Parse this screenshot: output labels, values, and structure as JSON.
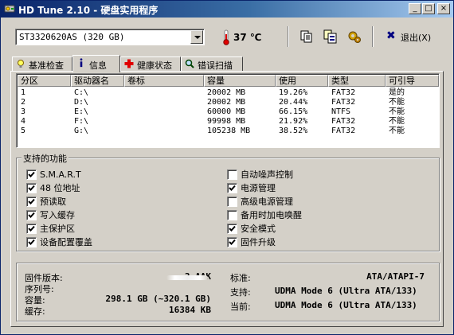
{
  "window": {
    "title": "HD Tune 2.10 - 硬盘实用程序",
    "min_label": "_",
    "max_label": "□",
    "close_label": "×"
  },
  "toolbar": {
    "drive": "ST3320620AS (320 GB)",
    "temperature": "37 ℃",
    "exit_label": "退出(X)"
  },
  "tabs": [
    {
      "label": "基准检查",
      "icon": "bulb-icon"
    },
    {
      "label": "信息",
      "icon": "info-icon",
      "active": true
    },
    {
      "label": "健康状态",
      "icon": "red-cross-icon"
    },
    {
      "label": "错误扫描",
      "icon": "magnifier-icon"
    }
  ],
  "partitions": {
    "headers": [
      "分区",
      "驱动器名",
      "卷标",
      "容量",
      "使用",
      "类型",
      "可引导"
    ],
    "rows": [
      [
        "1",
        "C:\\",
        "",
        "20002 MB",
        "19.26%",
        "FAT32",
        "是的"
      ],
      [
        "2",
        "D:\\",
        "",
        "20002 MB",
        "20.44%",
        "FAT32",
        "不能"
      ],
      [
        "3",
        "E:\\",
        "",
        "60000 MB",
        "66.15%",
        "NTFS",
        "不能"
      ],
      [
        "4",
        "F:\\",
        "",
        "99998 MB",
        "21.92%",
        "FAT32",
        "不能"
      ],
      [
        "5",
        "G:\\",
        "",
        "105238 MB",
        "38.52%",
        "FAT32",
        "不能"
      ]
    ]
  },
  "features": {
    "title": "支持的功能",
    "left": [
      {
        "label": "S.M.A.R.T",
        "checked": true
      },
      {
        "label": "48 位地址",
        "checked": true
      },
      {
        "label": "预读取",
        "checked": true
      },
      {
        "label": "写入缓存",
        "checked": true
      },
      {
        "label": "主保护区",
        "checked": true
      },
      {
        "label": "设备配置覆盖",
        "checked": true
      }
    ],
    "right": [
      {
        "label": "自动噪声控制",
        "checked": false
      },
      {
        "label": "电源管理",
        "checked": true
      },
      {
        "label": "高级电源管理",
        "checked": false
      },
      {
        "label": "备用时加电唤醒",
        "checked": false
      },
      {
        "label": "安全模式",
        "checked": true
      },
      {
        "label": "固件升级",
        "checked": true
      }
    ]
  },
  "info": {
    "firmware_label": "固件版本:",
    "firmware_value": "3.AAK",
    "serial_label": "序列号:",
    "capacity_label": "容量:",
    "capacity_value": "298.1 GB (~320.1 GB)",
    "buffer_label": "缓存:",
    "buffer_value": "16384 KB",
    "standard_label": "标准:",
    "standard_value": "ATA/ATAPI-7",
    "supported_label": "支持:",
    "supported_value": "UDMA Mode 6 (Ultra ATA/133)",
    "current_label": "当前:",
    "current_value": "UDMA Mode 6 (Ultra ATA/133)"
  }
}
